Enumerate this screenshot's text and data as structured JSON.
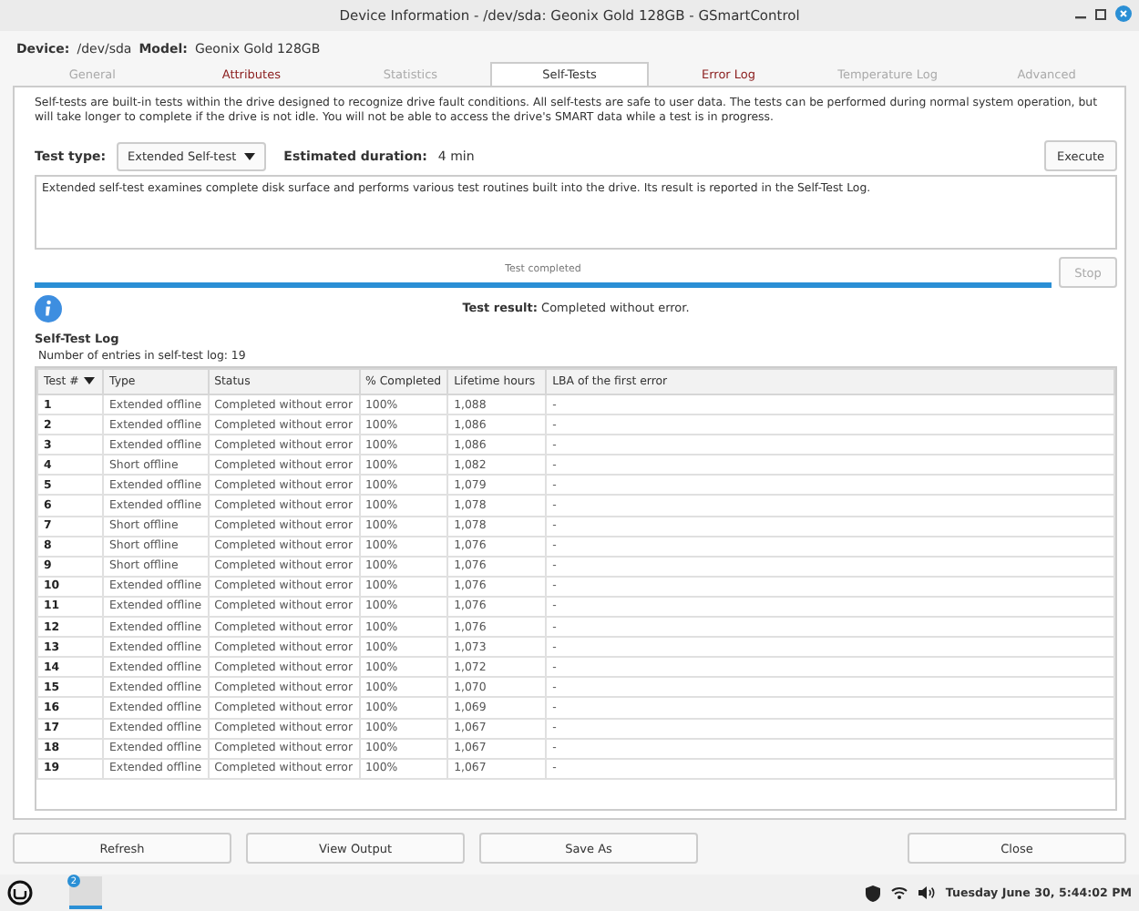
{
  "window": {
    "title": "Device Information - /dev/sda: Geonix Gold 128GB - GSmartControl"
  },
  "device": {
    "device_label": "Device:",
    "device": "/dev/sda",
    "model_label": "Model:",
    "model": "Geonix Gold 128GB"
  },
  "tabs": [
    {
      "label": "General",
      "selected": false,
      "disabled": true,
      "warning": false
    },
    {
      "label": "Attributes",
      "selected": false,
      "disabled": false,
      "warning": true
    },
    {
      "label": "Statistics",
      "selected": false,
      "disabled": true,
      "warning": false
    },
    {
      "label": "Self-Tests",
      "selected": true,
      "disabled": false,
      "warning": false
    },
    {
      "label": "Error Log",
      "selected": false,
      "disabled": false,
      "warning": true
    },
    {
      "label": "Temperature Log",
      "selected": false,
      "disabled": true,
      "warning": false
    },
    {
      "label": "Advanced",
      "selected": false,
      "disabled": true,
      "warning": false
    }
  ],
  "intro": "Self-tests are built-in tests within the drive designed to recognize drive fault conditions. All self-tests are safe to user data. The tests can be performed during normal system operation, but will take longer to complete if the drive is not idle. You will not be able to access the drive's SMART data while a test is in progress.",
  "test_type": {
    "label": "Test type:",
    "value": "Extended Self-test"
  },
  "duration": {
    "label": "Estimated duration:",
    "value": "4 min"
  },
  "execute_button": {
    "label": "Execute",
    "disabled": false
  },
  "description": "Extended self-test examines complete disk surface and performs various test routines built into the drive. Its result is reported in the Self-Test Log.",
  "progress": {
    "label": "Test completed",
    "level": 1
  },
  "stop_button": {
    "label": "Stop",
    "disabled": true
  },
  "result": {
    "label": "Test result:",
    "value": "Completed without error."
  },
  "log": {
    "title": "Self-Test Log",
    "count": "Number of entries in self-test log: 19",
    "columns": [
      {
        "label": "Test #",
        "sorted": true
      },
      {
        "label": "Type",
        "sorted": false
      },
      {
        "label": "Status",
        "sorted": false
      },
      {
        "label": "% Completed",
        "sorted": false
      },
      {
        "label": "Lifetime hours",
        "sorted": false
      },
      {
        "label": "LBA of the first error",
        "sorted": false
      }
    ],
    "rows": [
      [
        "1",
        "Extended offline",
        "Completed without error",
        "100%",
        "1,088",
        "-"
      ],
      [
        "2",
        "Extended offline",
        "Completed without error",
        "100%",
        "1,086",
        "-"
      ],
      [
        "3",
        "Extended offline",
        "Completed without error",
        "100%",
        "1,086",
        "-"
      ],
      [
        "4",
        "Short offline",
        "Completed without error",
        "100%",
        "1,082",
        "-"
      ],
      [
        "5",
        "Extended offline",
        "Completed without error",
        "100%",
        "1,079",
        "-"
      ],
      [
        "6",
        "Extended offline",
        "Completed without error",
        "100%",
        "1,078",
        "-"
      ],
      [
        "7",
        "Short offline",
        "Completed without error",
        "100%",
        "1,078",
        "-"
      ],
      [
        "8",
        "Short offline",
        "Completed without error",
        "100%",
        "1,076",
        "-"
      ],
      [
        "9",
        "Short offline",
        "Completed without error",
        "100%",
        "1,076",
        "-"
      ],
      [
        "10",
        "Extended offline",
        "Completed without error",
        "100%",
        "1,076",
        "-"
      ],
      [
        "11",
        "Extended offline",
        "Completed without error",
        "100%",
        "1,076",
        "-"
      ],
      [
        "12",
        "Extended offline",
        "Completed without error",
        "100%",
        "1,076",
        "-"
      ],
      [
        "13",
        "Extended offline",
        "Completed without error",
        "100%",
        "1,073",
        "-"
      ],
      [
        "14",
        "Extended offline",
        "Completed without error",
        "100%",
        "1,072",
        "-"
      ],
      [
        "15",
        "Extended offline",
        "Completed without error",
        "100%",
        "1,070",
        "-"
      ],
      [
        "16",
        "Extended offline",
        "Completed without error",
        "100%",
        "1,069",
        "-"
      ],
      [
        "17",
        "Extended offline",
        "Completed without error",
        "100%",
        "1,067",
        "-"
      ],
      [
        "18",
        "Extended offline",
        "Completed without error",
        "100%",
        "1,067",
        "-"
      ],
      [
        "19",
        "Extended offline",
        "Completed without error",
        "100%",
        "1,067",
        "-"
      ]
    ]
  },
  "buttons": [
    {
      "label": "Refresh",
      "kind": "left"
    },
    {
      "label": "View Output",
      "kind": "left"
    },
    {
      "label": "Save As",
      "kind": "left"
    },
    {
      "label": "Close",
      "kind": "right"
    }
  ],
  "taskbar": {
    "badge": "2",
    "clock": "Tuesday June 30, 5:44:02 PM"
  }
}
